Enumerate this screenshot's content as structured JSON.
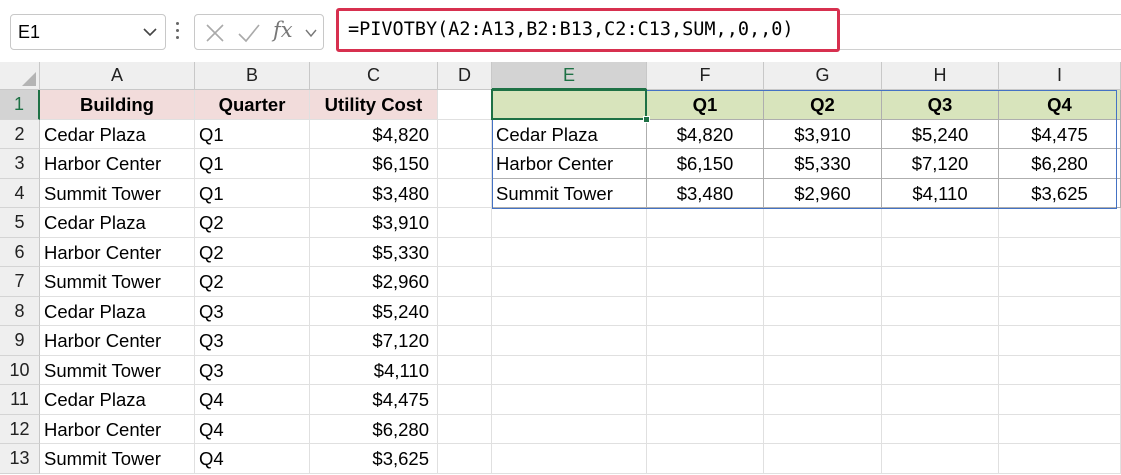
{
  "formula_bar": {
    "name_box": "E1",
    "fx_label": "fx",
    "formula": "=PIVOTBY(A2:A13,B2:B13,C2:C13,SUM,,0,,0)"
  },
  "columns": [
    "A",
    "B",
    "C",
    "D",
    "E",
    "F",
    "G",
    "H",
    "I"
  ],
  "rows": [
    "1",
    "2",
    "3",
    "4",
    "5",
    "6",
    "7",
    "8",
    "9",
    "10",
    "11",
    "12",
    "13"
  ],
  "source_table": {
    "headers": [
      "Building",
      "Quarter",
      "Utility Cost"
    ],
    "rows": [
      [
        "Cedar Plaza",
        "Q1",
        "$4,820"
      ],
      [
        "Harbor Center",
        "Q1",
        "$6,150"
      ],
      [
        "Summit Tower",
        "Q1",
        "$3,480"
      ],
      [
        "Cedar Plaza",
        "Q2",
        "$3,910"
      ],
      [
        "Harbor Center",
        "Q2",
        "$5,330"
      ],
      [
        "Summit Tower",
        "Q2",
        "$2,960"
      ],
      [
        "Cedar Plaza",
        "Q3",
        "$5,240"
      ],
      [
        "Harbor Center",
        "Q3",
        "$7,120"
      ],
      [
        "Summit Tower",
        "Q3",
        "$4,110"
      ],
      [
        "Cedar Plaza",
        "Q4",
        "$4,475"
      ],
      [
        "Harbor Center",
        "Q4",
        "$6,280"
      ],
      [
        "Summit Tower",
        "Q4",
        "$3,625"
      ]
    ]
  },
  "pivot_table": {
    "corner": "",
    "headers": [
      "Q1",
      "Q2",
      "Q3",
      "Q4"
    ],
    "rows": [
      [
        "Cedar Plaza",
        "$4,820",
        "$3,910",
        "$5,240",
        "$4,475"
      ],
      [
        "Harbor Center",
        "$6,150",
        "$5,330",
        "$7,120",
        "$6,280"
      ],
      [
        "Summit Tower",
        "$3,480",
        "$2,960",
        "$4,110",
        "$3,625"
      ]
    ]
  },
  "colors": {
    "source_header_fill": "#f2dcdb",
    "pivot_header_fill": "#d8e4bc",
    "selection": "#1e7145",
    "formula_highlight": "#d7304f",
    "pivot_border": "#4472c4"
  }
}
